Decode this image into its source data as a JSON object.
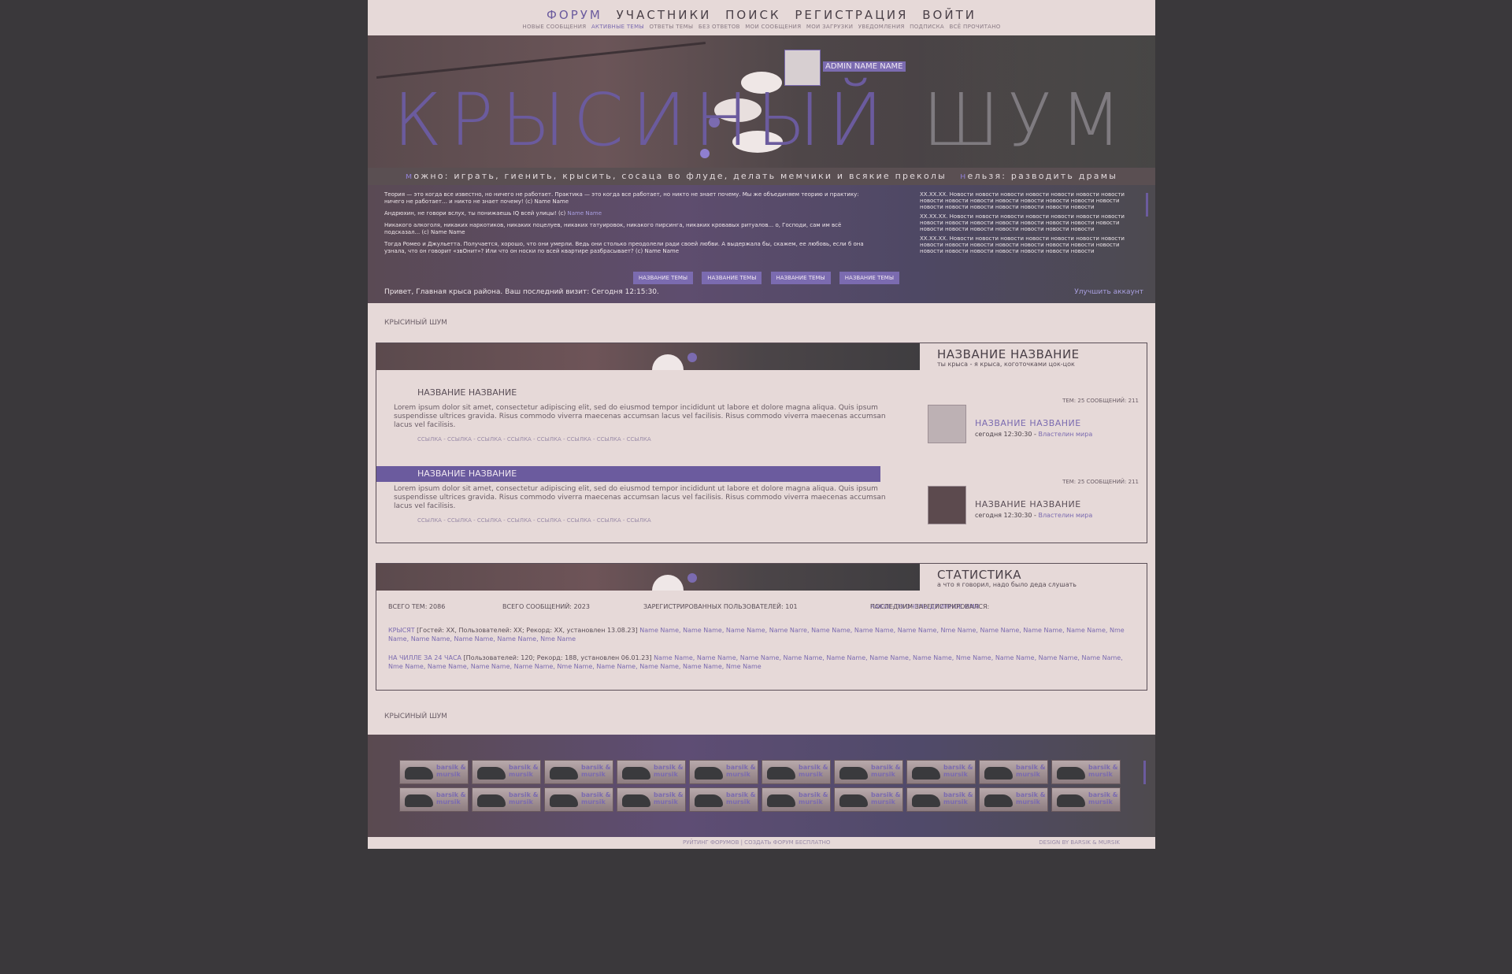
{
  "nav": {
    "main": [
      "ФОРУМ",
      "УЧАСТНИКИ",
      "ПОИСК",
      "РЕГИСТРАЦИЯ",
      "ВОЙТИ"
    ],
    "sub": [
      "НОВЫЕ СООБЩЕНИЯ",
      "АКТИВНЫЕ ТЕМЫ",
      "ОТВЕТЫ ТЕМЫ",
      "БЕЗ ОТВЕТОВ",
      "МОИ СООБЩЕНИЯ",
      "МОИ ЗАГРУЗКИ",
      "УВЕДОМЛЕНИЯ",
      "ПОДПИСКА",
      "ВСЁ ПРОЧИТАНО"
    ]
  },
  "header": {
    "admin_name": "ADMIN NAME NAME",
    "logo_1": "КРЫСИНЫЙ",
    "logo_2": "ШУМ",
    "tag_can_letter": "м",
    "tag_can": "ожно: играть, гиенить, крысить, сосаца во флуде, делать мемчики и всякие преколы",
    "tag_cannot_letter": "н",
    "tag_cannot": "ельзя: разводить драмы"
  },
  "quotes": [
    {
      "text": "Теория — это когда все известно, но ничего не работает. Практика — это когда все работает, но никто не знает почему. Мы же объединяем теорию и практику: ничего не работает… и никто не знает почему! (с) Name Name",
      "name": ""
    },
    {
      "text": "Андрюхин, не говори вслух, ты понижаешь IQ всей улицы! (с)",
      "name": "Name Name"
    },
    {
      "text": "Никакого алкоголя, никаких наркотиков, никаких поцелуев, никаких татуировок, никакого пирсинга, никаких кровавых ритуалов... о, Господи, сам им всё подсказал... (с) Name Name",
      "name": ""
    },
    {
      "text": "Тогда Ромео и Джульетта. Получается, хорошо, что они умерли. Ведь они столько преодолели ради своей любви. А выдержала бы, скажем, ее любовь, если б она узнала, что он говорит «звОнит»? Или что он носки по всей квартире разбрасывает? (с) Name Name",
      "name": ""
    }
  ],
  "topics": [
    "НАЗВАНИЕ ТЕМЫ",
    "НАЗВАНИЕ ТЕМЫ",
    "НАЗВАНИЕ ТЕМЫ",
    "НАЗВАНИЕ ТЕМЫ"
  ],
  "news": [
    "XX.XX.XX. Новости новости новости новости новости новости новости новости новости новости новости новости новости новости новости новости новости новости новости новости новости новости",
    "XX.XX.XX. Новости новости новости новости новости новости новости новости новости новости новости новости новости новости новости новости новости новости новости новости новости новости",
    "XX.XX.XX. Новости новости новости новости новости новости новости новости новости новости новости новости новости новости новости новости новости новости новости новости новости новости"
  ],
  "welcome": "Привет, Главная крыса района. Ваш последний визит: Сегодня 12:15:30.",
  "upgrade": "Улучшить аккаунт",
  "crumb": "КРЫСИНЫЙ ШУМ",
  "category": {
    "title": "НАЗВАНИЕ НАЗВАНИЕ",
    "subtitle": "ты крыса - я крыса, коготочками цок-цок",
    "forums": [
      {
        "name": "НАЗВАНИЕ НАЗВАНИЕ",
        "desc": "Lorem ipsum dolor sit amet, consectetur adipiscing elit, sed do eiusmod tempor incididunt ut labore et dolore magna aliqua. Quis ipsum suspendisse ultrices gravida. Risus commodo viverra maecenas accumsan lacus vel facilisis.  Risus commodo viverra maecenas accumsan lacus vel facilisis.",
        "links": "ССЫЛКА - ССЫЛКА - ССЫЛКА - ССЫЛКА - ССЫЛКА - ССЫЛКА - ССЫЛКА - ССЫЛКА",
        "stats": "ТЕМ: 25     СООБЩЕНИЙ: 211",
        "last_topic": "НАЗВАНИЕ НАЗВАНИЕ",
        "last_time": "сегодня 12:30:30 -",
        "last_user": "Властелин мира"
      },
      {
        "name": "НАЗВАНИЕ НАЗВАНИЕ",
        "desc": "Lorem ipsum dolor sit amet, consectetur adipiscing elit, sed do eiusmod tempor incididunt ut labore et dolore magna aliqua. Quis ipsum suspendisse ultrices gravida. Risus commodo viverra maecenas accumsan lacus vel facilisis.  Risus commodo viverra maecenas accumsan lacus vel facilisis.",
        "links": "ССЫЛКА - ССЫЛКА - ССЫЛКА - ССЫЛКА - ССЫЛКА - ССЫЛКА - ССЫЛКА - ССЫЛКА",
        "stats": "ТЕМ: 25     СООБЩЕНИЙ: 211",
        "last_topic": "НАЗВАНИЕ НАЗВАНИЕ",
        "last_time": "сегодня 12:30:30 -",
        "last_user": "Властелин мира"
      }
    ]
  },
  "stats": {
    "title": "СТАТИСТИКА",
    "subtitle": "а что я говорил, надо было деда слушать",
    "total_topics": "ВСЕГО ТЕМ: 2086",
    "total_posts": "ВСЕГО СООБЩЕНИЙ: 2023",
    "registered": "ЗАРЕГИСТРИРОВАННЫХ ПОЛЬЗОВАТЕЛЕЙ: 101",
    "last_reg_label": "ПОСЛЕДНИМ ЗАРЕГИСТРИРОВАЛСЯ:",
    "last_reg_name": "КАКОЕ-ТО ОЧЕНЬ ДЛИННОЕ ИМЯ",
    "online_label": "КРЫСЯТ",
    "online_info": "[Гостей: XX, Пользователей: XX; Рекорд: XX, установлен 13.08.23]",
    "online_names": "Name Name, Name Name, Name Name, Name Narre,  Name Name, Name Name, Name Name, Nme Name,  Name Name, Name Name, Name Name, Nme Name,  Name Name, Name Name, Name Name, Nme Name",
    "day_label": "НА ЧИЛЛЕ ЗА 24 ЧАСА",
    "day_info": "[Пользователей: 120; Рекорд: 188, установлен 06.01.23]",
    "day_names": "Name Name, Name Name, Name Name, Name Name,  Name Name, Name Name, Name Name, Nme Name,  Name Name, Name Name, Name Name, Nme Name,  Name Name, Name Name, Name Name, Nme Name, Name Name, Name Name, Name Name, Nme Name"
  },
  "crumb2": "КРЫСИНЫЙ ШУМ",
  "buttons": {
    "text": "barsik & mursik"
  },
  "footer": {
    "copy": "РУЙТИНГ ФОРУМОВ | СОЗДАТЬ ФОРУМ БЕСПЛАТНО",
    "design": "DESIGN BY BARSIK & MURSIK"
  }
}
